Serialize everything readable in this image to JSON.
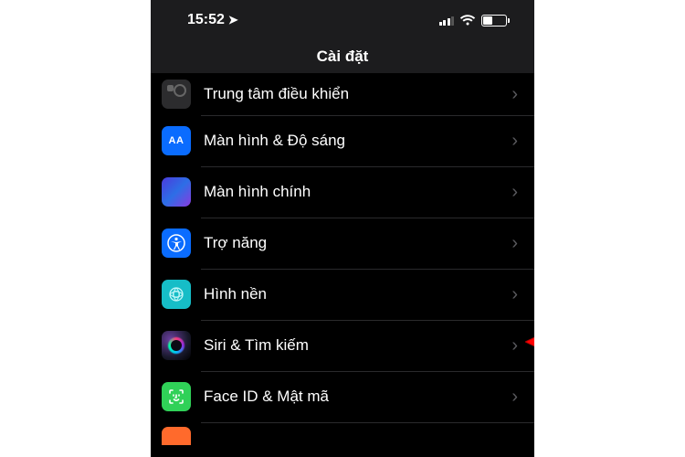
{
  "status": {
    "time": "15:52",
    "location_enabled": true
  },
  "nav": {
    "title": "Cài đặt"
  },
  "rows": [
    {
      "label": "Trung tâm điều khiển"
    },
    {
      "label": "Màn hình & Độ sáng"
    },
    {
      "label": "Màn hình chính"
    },
    {
      "label": "Trợ năng"
    },
    {
      "label": "Hình nền"
    },
    {
      "label": "Siri & Tìm kiếm"
    },
    {
      "label": "Face ID & Mật mã"
    }
  ],
  "annotation": {
    "target_row_index": 5
  }
}
